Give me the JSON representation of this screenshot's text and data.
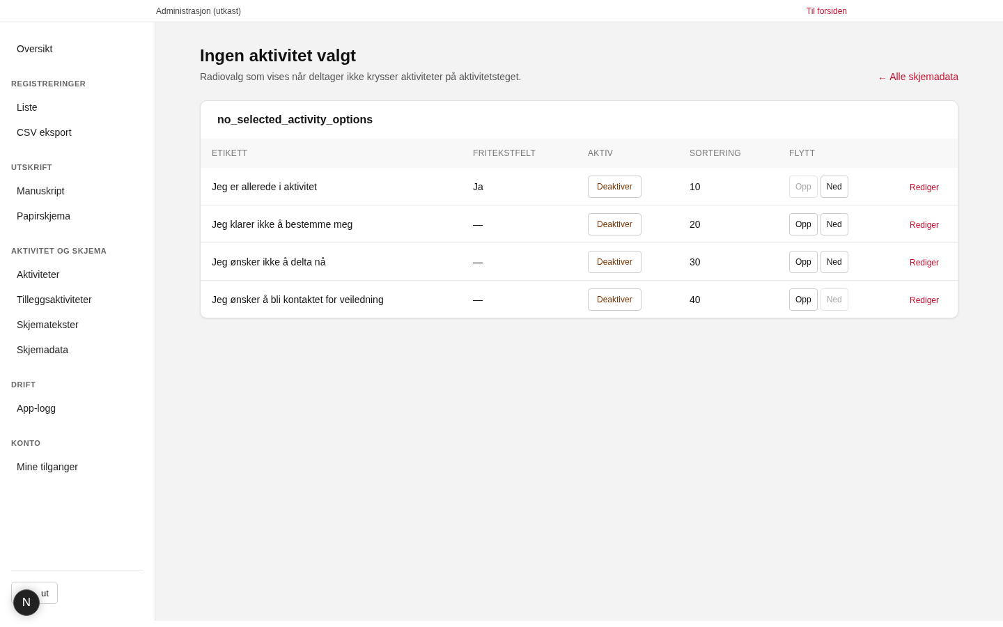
{
  "topbar": {
    "title": "Administrasjon (utkast)",
    "home_link": "Til forsiden"
  },
  "sidebar": {
    "sections": [
      {
        "items": [
          {
            "label": "Oversikt"
          }
        ]
      },
      {
        "heading": "REGISTRERINGER",
        "items": [
          {
            "label": "Liste"
          },
          {
            "label": "CSV eksport"
          }
        ]
      },
      {
        "heading": "UTSKRIFT",
        "items": [
          {
            "label": "Manuskript"
          },
          {
            "label": "Papirskjema"
          }
        ]
      },
      {
        "heading": "AKTIVITET OG SKJEMA",
        "items": [
          {
            "label": "Aktiviteter"
          },
          {
            "label": "Tilleggsaktiviteter"
          },
          {
            "label": "Skjematekster"
          },
          {
            "label": "Skjemadata"
          }
        ]
      },
      {
        "heading": "DRIFT",
        "items": [
          {
            "label": "App-logg"
          }
        ]
      },
      {
        "heading": "KONTO",
        "items": [
          {
            "label": "Mine tilganger"
          }
        ]
      }
    ],
    "logout_button": "ut",
    "dev_badge": "N"
  },
  "page": {
    "title": "Ingen aktivitet valgt",
    "description": "Radiovalg som vises når deltager ikke krysser aktiviteter på aktivitetsteget.",
    "back_link": "← Alle skjemadata"
  },
  "table": {
    "title": "no_selected_activity_options",
    "columns": [
      "ETIKETT",
      "FRITEKSTFELT",
      "AKTIV",
      "SORTERING",
      "FLYTT"
    ],
    "rows": [
      {
        "label": "Jeg er allerede i aktivitet",
        "free_text": "Ja",
        "toggle": "Deaktiver",
        "sort": "10",
        "up": "Opp",
        "up_disabled": true,
        "down": "Ned",
        "down_disabled": false,
        "edit": "Rediger"
      },
      {
        "label": "Jeg klarer ikke å bestemme meg",
        "free_text": "—",
        "toggle": "Deaktiver",
        "sort": "20",
        "up": "Opp",
        "up_disabled": false,
        "down": "Ned",
        "down_disabled": false,
        "edit": "Rediger"
      },
      {
        "label": "Jeg ønsker ikke å delta nå",
        "free_text": "—",
        "toggle": "Deaktiver",
        "sort": "30",
        "up": "Opp",
        "up_disabled": false,
        "down": "Ned",
        "down_disabled": false,
        "edit": "Rediger"
      },
      {
        "label": "Jeg ønsker å bli kontaktet for veiledning",
        "free_text": "—",
        "toggle": "Deaktiver",
        "sort": "40",
        "up": "Opp",
        "up_disabled": false,
        "down": "Ned",
        "down_disabled": true,
        "edit": "Rediger"
      }
    ]
  }
}
